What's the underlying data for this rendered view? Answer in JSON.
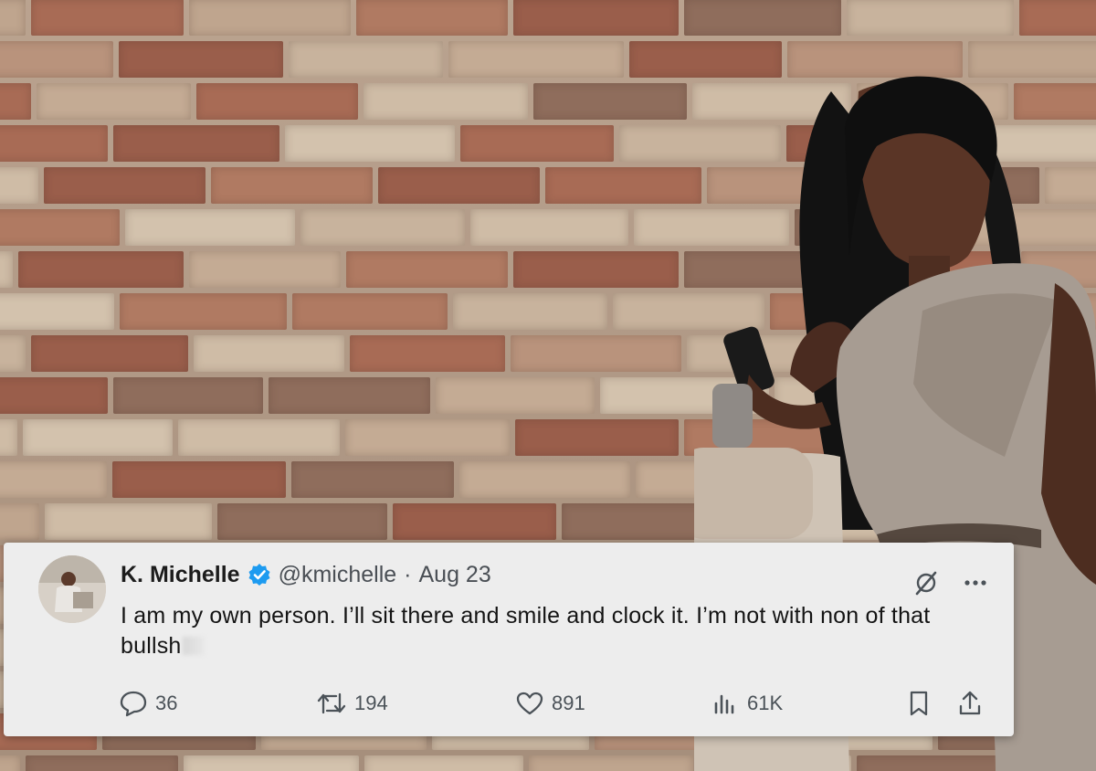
{
  "tweet": {
    "display_name": "K. Michelle",
    "handle": "@kmichelle",
    "separator": "·",
    "date": "Aug 23",
    "text": "I am my own person. I’ll sit there and smile and clock it. I’m not with non of that bullsh",
    "metrics": {
      "replies": "36",
      "reposts": "194",
      "likes": "891",
      "views": "61K"
    }
  },
  "icons": {
    "verified": "verified-badge-icon",
    "grok": "grok-icon",
    "more": "more-icon",
    "reply": "reply-icon",
    "repost": "repost-icon",
    "like": "heart-icon",
    "views": "views-icon",
    "bookmark": "bookmark-icon",
    "share": "share-icon"
  },
  "colors": {
    "verified_blue": "#1d9bf0",
    "card_background": "#ededed",
    "text_primary": "#141414",
    "text_secondary": "#4b5258"
  }
}
